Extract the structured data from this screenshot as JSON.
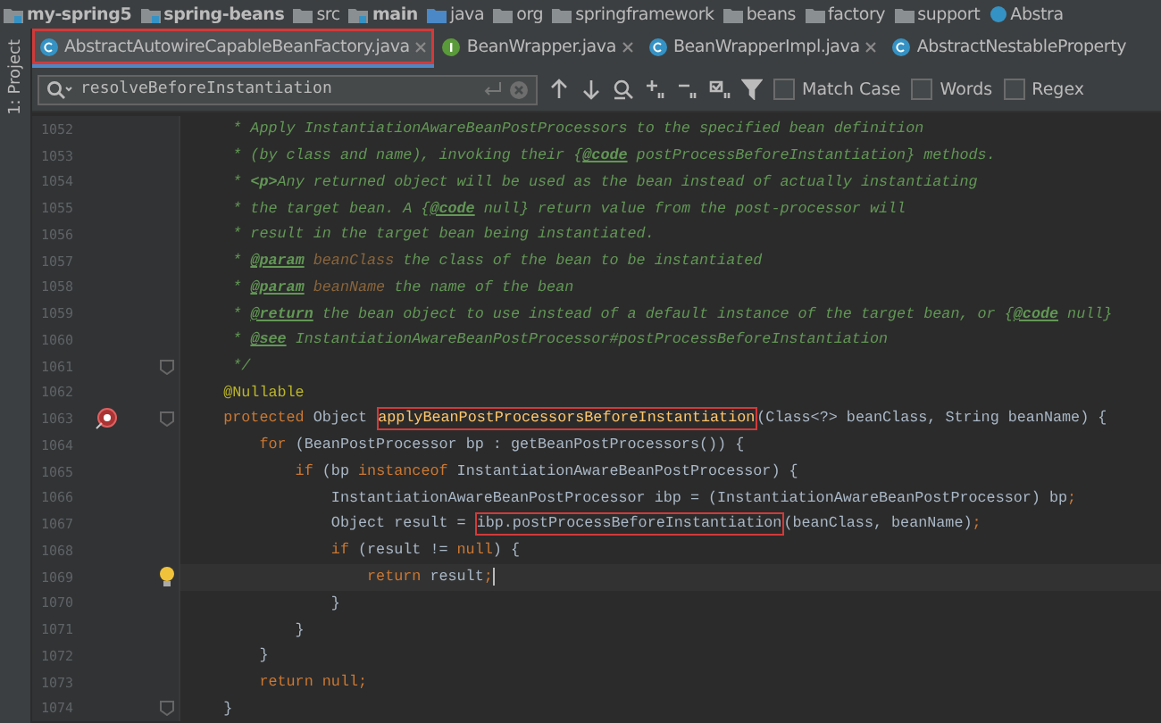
{
  "breadcrumbs": [
    {
      "label": "my-spring5",
      "kind": "module",
      "bold": true
    },
    {
      "label": "spring-beans",
      "kind": "module",
      "bold": true
    },
    {
      "label": "src",
      "kind": "folder",
      "bold": false
    },
    {
      "label": "main",
      "kind": "module",
      "bold": true
    },
    {
      "label": "java",
      "kind": "source",
      "bold": false
    },
    {
      "label": "org",
      "kind": "package",
      "bold": false
    },
    {
      "label": "springframework",
      "kind": "package",
      "bold": false
    },
    {
      "label": "beans",
      "kind": "package",
      "bold": false
    },
    {
      "label": "factory",
      "kind": "package",
      "bold": false
    },
    {
      "label": "support",
      "kind": "package",
      "bold": false
    },
    {
      "label": "Abstra",
      "kind": "class",
      "bold": false
    }
  ],
  "side_tab": {
    "label": "1: Project"
  },
  "tabs": [
    {
      "label": "AbstractAutowireCapableBeanFactory.java",
      "kind": "class",
      "selected": true,
      "boxed": true
    },
    {
      "label": "BeanWrapper.java",
      "kind": "interface",
      "selected": false,
      "boxed": false
    },
    {
      "label": "BeanWrapperImpl.java",
      "kind": "class",
      "selected": false,
      "boxed": false
    },
    {
      "label": "AbstractNestableProperty",
      "kind": "class",
      "selected": false,
      "boxed": false
    }
  ],
  "search": {
    "value": "resolveBeforeInstantiation",
    "options": [
      {
        "label": "Match Case",
        "checked": false
      },
      {
        "label": "Words",
        "checked": false
      },
      {
        "label": "Regex",
        "checked": false
      }
    ]
  },
  "lines": [
    {
      "number": "1052",
      "current": false,
      "fold": false,
      "override": false,
      "bulb": false,
      "tokens": [
        {
          "text": "     * Apply InstantiationAwareBeanPostProcessors to the specified bean definition",
          "kind": "comment"
        }
      ]
    },
    {
      "number": "1053",
      "current": false,
      "fold": false,
      "override": false,
      "bulb": false,
      "tokens": [
        {
          "text": "     * (by class and name), invoking their {",
          "kind": "comment"
        },
        {
          "text": "@code",
          "kind": "doctag"
        },
        {
          "text": " postProcessBeforeInstantiation} methods.",
          "kind": "comment"
        }
      ]
    },
    {
      "number": "1054",
      "current": false,
      "fold": false,
      "override": false,
      "bulb": false,
      "tokens": [
        {
          "text": "     * ",
          "kind": "comment"
        },
        {
          "text": "<p>",
          "kind": "html"
        },
        {
          "text": "Any returned object will be used as the bean instead of actually instantiating",
          "kind": "comment"
        }
      ]
    },
    {
      "number": "1055",
      "current": false,
      "fold": false,
      "override": false,
      "bulb": false,
      "tokens": [
        {
          "text": "     * the target bean. A {",
          "kind": "comment"
        },
        {
          "text": "@code",
          "kind": "doctag"
        },
        {
          "text": " null} return value from the post-processor will",
          "kind": "comment"
        }
      ]
    },
    {
      "number": "1056",
      "current": false,
      "fold": false,
      "override": false,
      "bulb": false,
      "tokens": [
        {
          "text": "     * result in the target bean being instantiated.",
          "kind": "comment"
        }
      ]
    },
    {
      "number": "1057",
      "current": false,
      "fold": false,
      "override": false,
      "bulb": false,
      "tokens": [
        {
          "text": "     * ",
          "kind": "comment"
        },
        {
          "text": "@param",
          "kind": "doctag"
        },
        {
          "text": " beanClass",
          "kind": "docparam"
        },
        {
          "text": " the class of the bean to be instantiated",
          "kind": "comment"
        }
      ]
    },
    {
      "number": "1058",
      "current": false,
      "fold": false,
      "override": false,
      "bulb": false,
      "tokens": [
        {
          "text": "     * ",
          "kind": "comment"
        },
        {
          "text": "@param",
          "kind": "doctag"
        },
        {
          "text": " beanName",
          "kind": "docparam"
        },
        {
          "text": " the name of the bean",
          "kind": "comment"
        }
      ]
    },
    {
      "number": "1059",
      "current": false,
      "fold": false,
      "override": false,
      "bulb": false,
      "tokens": [
        {
          "text": "     * ",
          "kind": "comment"
        },
        {
          "text": "@return",
          "kind": "doctag"
        },
        {
          "text": " the bean object to use instead of a default instance of the target bean, or {",
          "kind": "comment"
        },
        {
          "text": "@code",
          "kind": "doctag"
        },
        {
          "text": " null}",
          "kind": "comment"
        }
      ]
    },
    {
      "number": "1060",
      "current": false,
      "fold": false,
      "override": false,
      "bulb": false,
      "tokens": [
        {
          "text": "     * ",
          "kind": "comment"
        },
        {
          "text": "@see",
          "kind": "doctag"
        },
        {
          "text": " InstantiationAwareBeanPostProcessor#postProcessBeforeInstantiation",
          "kind": "comment"
        }
      ]
    },
    {
      "number": "1061",
      "current": false,
      "fold": true,
      "override": false,
      "bulb": false,
      "tokens": [
        {
          "text": "     */",
          "kind": "comment"
        }
      ]
    },
    {
      "number": "1062",
      "current": false,
      "fold": false,
      "override": false,
      "bulb": false,
      "tokens": [
        {
          "text": "    @Nullable",
          "kind": "annotation"
        }
      ]
    },
    {
      "number": "1063",
      "current": false,
      "fold": true,
      "override": true,
      "bulb": false,
      "tokens": [
        {
          "text": "    protected",
          "kind": "keyword"
        },
        {
          "text": " Object ",
          "kind": "code"
        },
        {
          "text": "applyBeanPostProcessorsBeforeInstantiation",
          "kind": "method",
          "boxed": true
        },
        {
          "text": "(Class<?> beanClass, String beanName) {",
          "kind": "code"
        }
      ]
    },
    {
      "number": "1064",
      "current": false,
      "fold": false,
      "override": false,
      "bulb": false,
      "tokens": [
        {
          "text": "        for",
          "kind": "keyword"
        },
        {
          "text": " (BeanPostProcessor bp : getBeanPostProcessors()) {",
          "kind": "code"
        }
      ]
    },
    {
      "number": "1065",
      "current": false,
      "fold": false,
      "override": false,
      "bulb": false,
      "tokens": [
        {
          "text": "            if",
          "kind": "keyword"
        },
        {
          "text": " (bp ",
          "kind": "code"
        },
        {
          "text": "instanceof",
          "kind": "keyword"
        },
        {
          "text": " InstantiationAwareBeanPostProcessor) {",
          "kind": "code"
        }
      ]
    },
    {
      "number": "1066",
      "current": false,
      "fold": false,
      "override": false,
      "bulb": false,
      "tokens": [
        {
          "text": "                InstantiationAwareBeanPostProcessor ibp = (InstantiationAwareBeanPostProcessor) bp",
          "kind": "code"
        },
        {
          "text": ";",
          "kind": "keyword"
        }
      ]
    },
    {
      "number": "1067",
      "current": false,
      "fold": false,
      "override": false,
      "bulb": false,
      "tokens": [
        {
          "text": "                Object result = ",
          "kind": "code"
        },
        {
          "text": "ibp.postProcessBeforeInstantiation",
          "kind": "code",
          "boxed": true
        },
        {
          "text": "(beanClass, beanName)",
          "kind": "code"
        },
        {
          "text": ";",
          "kind": "keyword"
        }
      ]
    },
    {
      "number": "1068",
      "current": false,
      "fold": false,
      "override": false,
      "bulb": false,
      "tokens": [
        {
          "text": "                if",
          "kind": "keyword"
        },
        {
          "text": " (result != ",
          "kind": "code"
        },
        {
          "text": "null",
          "kind": "keyword"
        },
        {
          "text": ") {",
          "kind": "code"
        }
      ]
    },
    {
      "number": "1069",
      "current": true,
      "fold": false,
      "override": false,
      "bulb": true,
      "tokens": [
        {
          "text": "                    return",
          "kind": "keyword"
        },
        {
          "text": " result",
          "kind": "code"
        },
        {
          "text": ";",
          "kind": "keyword"
        }
      ]
    },
    {
      "number": "1070",
      "current": false,
      "fold": false,
      "override": false,
      "bulb": false,
      "tokens": [
        {
          "text": "                }",
          "kind": "code"
        }
      ]
    },
    {
      "number": "1071",
      "current": false,
      "fold": false,
      "override": false,
      "bulb": false,
      "tokens": [
        {
          "text": "            }",
          "kind": "code"
        }
      ]
    },
    {
      "number": "1072",
      "current": false,
      "fold": false,
      "override": false,
      "bulb": false,
      "tokens": [
        {
          "text": "        }",
          "kind": "code"
        }
      ]
    },
    {
      "number": "1073",
      "current": false,
      "fold": false,
      "override": false,
      "bulb": false,
      "tokens": [
        {
          "text": "        return",
          "kind": "keyword"
        },
        {
          "text": " null;",
          "kind": "keyword"
        }
      ]
    },
    {
      "number": "1074",
      "current": false,
      "fold": true,
      "override": false,
      "bulb": false,
      "tokens": [
        {
          "text": "    }",
          "kind": "code"
        }
      ]
    }
  ]
}
